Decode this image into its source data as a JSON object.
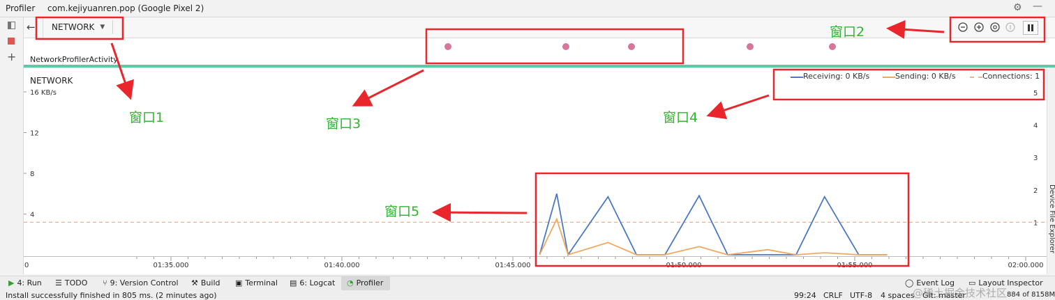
{
  "window": {
    "app_name": "Profiler",
    "session": "com.kejiyuanren.pop (Google Pixel 2)"
  },
  "toolbar": {
    "back_icon": "arrow-left-icon",
    "profiler_select": "NETWORK"
  },
  "activity": {
    "name": "NetworkProfilerActivity"
  },
  "chart": {
    "section_title": "NETWORK",
    "unit": "16 KB/s"
  },
  "legend": {
    "receiving": "Receiving: 0 KB/s",
    "sending": "Sending: 0 KB/s",
    "connections": "Connections: 1"
  },
  "annotations": [
    "窗口1",
    "窗口2",
    "窗口3",
    "窗口4",
    "窗口5"
  ],
  "tool_windows": {
    "run": "4: Run",
    "todo": "TODO",
    "vcs": "9: Version Control",
    "build": "Build",
    "terminal": "Terminal",
    "logcat": "6: Logcat",
    "profiler": "Profiler",
    "event_log": "Event Log",
    "layout_inspector": "Layout Inspector"
  },
  "status": {
    "message": "Install successfully finished in 805 ms. (2 minutes ago)",
    "position": "99:24",
    "line_sep": "CRLF",
    "encoding": "UTF-8",
    "indent": "4 spaces",
    "git": "Git: master",
    "memory": "884 of 8158M"
  },
  "side_panel": {
    "device_file_explorer": "Device File Explorer"
  },
  "watermark": "@稀土掘金技术社区",
  "colors": {
    "receiving": "#4a78c2",
    "sending": "#f0a860",
    "connections": "#f2b08f",
    "activity_bar": "#5ec9a6",
    "annotation_box": "#e8262b",
    "annotation_text": "#2fb52f",
    "event_dot": "#d9749b"
  },
  "chart_data": {
    "type": "line",
    "x": [
      "01:45:47",
      "01:46:17",
      "01:46:37",
      "01:47:47",
      "01:48:37",
      "01:49:27",
      "01:50:27",
      "01:51:17",
      "01:52:27",
      "01:53:17",
      "01:54:07",
      "01:55:07",
      "01:55:57"
    ],
    "x_ticks": [
      "0",
      "01:35.000",
      "01:40.000",
      "01:45.000",
      "01:50.000",
      "01:55.000",
      "02:00.000"
    ],
    "series": [
      {
        "name": "Receiving",
        "values": [
          0,
          6.0,
          0,
          5.7,
          0,
          0,
          5.8,
          0,
          0,
          0,
          5.7,
          0,
          0
        ]
      },
      {
        "name": "Sending",
        "values": [
          0,
          3.5,
          0,
          1.2,
          0,
          0,
          0.8,
          0,
          0.5,
          0,
          0.2,
          0,
          0
        ]
      }
    ],
    "connections_level": 1,
    "y_ticks_left": [
      "4",
      "8",
      "12",
      "16 KB/s"
    ],
    "y_ticks_right": [
      "1",
      "2",
      "3",
      "4",
      "5"
    ],
    "ylim_left": [
      0,
      16
    ],
    "ylim_right": [
      0,
      5
    ]
  }
}
